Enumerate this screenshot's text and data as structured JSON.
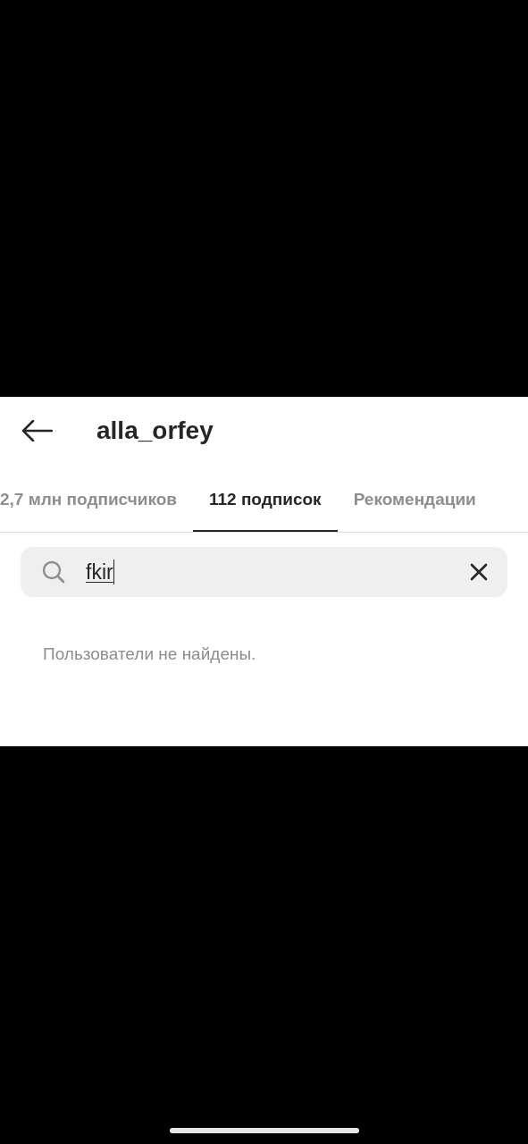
{
  "header": {
    "title": "alla_orfey"
  },
  "tabs": [
    {
      "label": "2,7 млн подписчиков",
      "selected": false
    },
    {
      "label": "112 подписок",
      "selected": true
    },
    {
      "label": "Рекомендации",
      "selected": false
    }
  ],
  "search": {
    "value": "fkir"
  },
  "empty_message": "Пользователи не найдены."
}
